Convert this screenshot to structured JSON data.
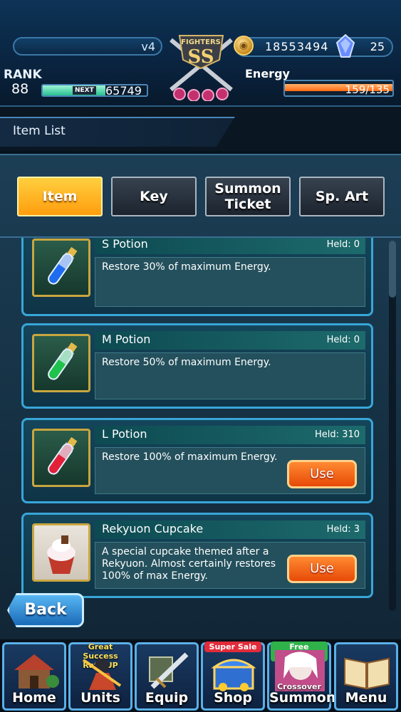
{
  "status": {
    "version": "v4",
    "emblem_text": "FIGHTERS SS",
    "coins": "18553494",
    "gems": "25",
    "rank_label": "RANK",
    "rank": "88",
    "next_label": "NEXT",
    "next_exp": "65749",
    "exp_progress": 0.6,
    "energy_label": "Energy",
    "energy_text": "159/135",
    "energy_progress": 1.0
  },
  "header": {
    "title": "Item List"
  },
  "tabs": [
    {
      "label": "Item",
      "active": true
    },
    {
      "label": "Key",
      "active": false
    },
    {
      "label": "Summon Ticket",
      "active": false
    },
    {
      "label": "Sp. Art",
      "active": false
    }
  ],
  "items": [
    {
      "name": "S Potion",
      "held": "Held: 0",
      "desc": "Restore 30% of maximum Energy.",
      "icon": "blue-potion-icon",
      "use": ""
    },
    {
      "name": "M Potion",
      "held": "Held: 0",
      "desc": "Restore 50% of maximum Energy.",
      "icon": "green-potion-icon",
      "use": ""
    },
    {
      "name": "L Potion",
      "held": "Held: 310",
      "desc": "Restore 100% of maximum Energy.",
      "icon": "red-potion-icon",
      "use": "Use"
    },
    {
      "name": "Rekyuon Cupcake",
      "held": "Held: 3",
      "desc": "A special cupcake themed after a Rekyuon. Almost certainly restores 100% of max Energy.",
      "icon": "cupcake-icon",
      "use": "Use"
    }
  ],
  "back_label": "Back",
  "nav": [
    {
      "label": "Home",
      "badge": ""
    },
    {
      "label": "Units",
      "badge": "Great Success Rate UP"
    },
    {
      "label": "Equip",
      "badge": ""
    },
    {
      "label": "Shop",
      "badge": "Super Sale"
    },
    {
      "label": "Summon",
      "badge": "Free Summon",
      "sub": "Crossover"
    },
    {
      "label": "Menu",
      "badge": ""
    }
  ],
  "colors": {
    "accent": "#ff9d0d",
    "card_border": "#38a6d8",
    "use_button": "#e74a07"
  }
}
